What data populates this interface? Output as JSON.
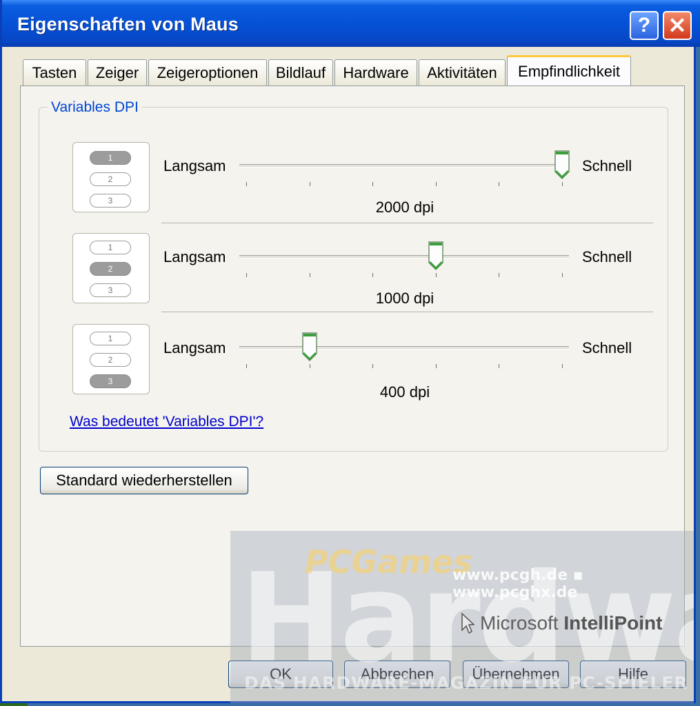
{
  "window": {
    "title": "Eigenschaften von Maus",
    "help_glyph": "?",
    "close_glyph": "✕"
  },
  "tabs": [
    {
      "label": "Tasten",
      "active": false
    },
    {
      "label": "Zeiger",
      "active": false
    },
    {
      "label": "Zeigeroptionen",
      "active": false
    },
    {
      "label": "Bildlauf",
      "active": false
    },
    {
      "label": "Hardware",
      "active": false
    },
    {
      "label": "Aktivitäten",
      "active": false
    },
    {
      "label": "Empfindlichkeit",
      "active": true
    }
  ],
  "group": {
    "title": "Variables DPI",
    "rows": [
      {
        "setting": "1",
        "slow_label": "Langsam",
        "fast_label": "Schnell",
        "dpi_label": "2000 dpi",
        "slider_position": 1.0
      },
      {
        "setting": "2",
        "slow_label": "Langsam",
        "fast_label": "Schnell",
        "dpi_label": "1000 dpi",
        "slider_position": 0.6
      },
      {
        "setting": "3",
        "slow_label": "Langsam",
        "fast_label": "Schnell",
        "dpi_label": "400 dpi",
        "slider_position": 0.2
      }
    ],
    "pill_labels": [
      "1",
      "2",
      "3"
    ],
    "help_link": "Was bedeutet 'Variables DPI'?"
  },
  "restore_button": "Standard wiederherstellen",
  "footer": {
    "ok": "OK",
    "cancel": "Abbrechen",
    "apply": "Übernehmen",
    "help": "Hilfe"
  },
  "watermark": {
    "pc_games": "PCGames",
    "hardware": "Hardware",
    "urls": "www.pcgh.de ▪ www.pcghx.de",
    "product_prefix": "Microsoft",
    "product_name": "IntelliPoint",
    "tagline": "DAS HARDWARE-MAGAZIN FÜR PC-SPIELER"
  },
  "colors": {
    "titlebar": "#0651d6",
    "accent_link": "#0000cc",
    "group_title": "#0046d5",
    "active_tab_highlight": "#ffc83c",
    "slider_thumb": "#3d9e3d"
  }
}
